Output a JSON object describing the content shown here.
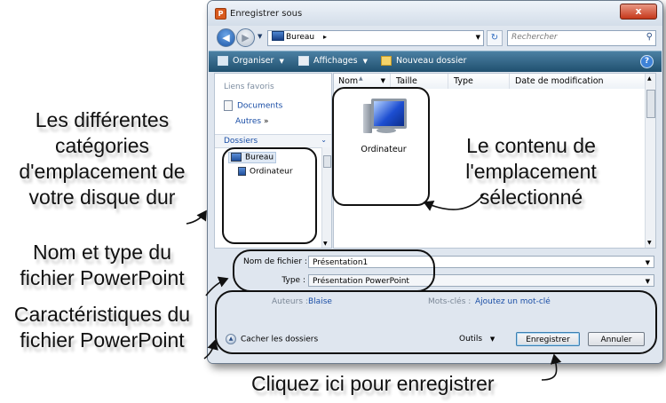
{
  "window": {
    "title": "Enregistrer sous",
    "close_symbol": "x"
  },
  "address_bar": {
    "path": "Bureau",
    "search_placeholder": "Rechercher"
  },
  "toolbar": {
    "organize_label": "Organiser",
    "views_label": "Affichages",
    "new_folder_label": "Nouveau dossier",
    "help_symbol": "?"
  },
  "nav_pane": {
    "favorites_header": "Liens favoris",
    "favorites": [
      {
        "label": "Documents"
      },
      {
        "label": "Autres"
      }
    ],
    "more_arrows": "»",
    "folders_header": "Dossiers",
    "tree": [
      {
        "label": "Bureau",
        "selected": true
      },
      {
        "label": "Ordinateur",
        "selected": false
      }
    ]
  },
  "file_list": {
    "columns": [
      "Nom",
      "Taille",
      "Type",
      "Date de modification"
    ],
    "items": [
      {
        "label": "Ordinateur",
        "icon": "computer-icon"
      }
    ]
  },
  "form": {
    "filename_label": "Nom de fichier :",
    "filename_value": "Présentation1",
    "type_label": "Type :",
    "type_value": "Présentation PowerPoint",
    "authors_label": "Auteurs :",
    "authors_value": "Blaise",
    "keywords_label": "Mots-clés :",
    "keywords_value": "Ajoutez un mot-clé",
    "hide_folders_label": "Cacher les dossiers",
    "tools_label": "Outils",
    "save_label": "Enregistrer",
    "cancel_label": "Annuler"
  },
  "annotations": {
    "categories": [
      "Les différentes",
      "catégories",
      "d'emplacement de",
      "votre disque dur"
    ],
    "content": [
      "Le contenu de",
      "l'emplacement",
      "sélectionné"
    ],
    "name_type": [
      "Nom et type du",
      "fichier PowerPoint"
    ],
    "characteristics": [
      "Caractéristiques du",
      "fichier PowerPoint"
    ],
    "save_hint": "Cliquez ici pour enregistrer"
  },
  "colors": {
    "toolbar": "#20506f",
    "link": "#1a4ea6",
    "dialog_bg": "#dfe6ef"
  }
}
